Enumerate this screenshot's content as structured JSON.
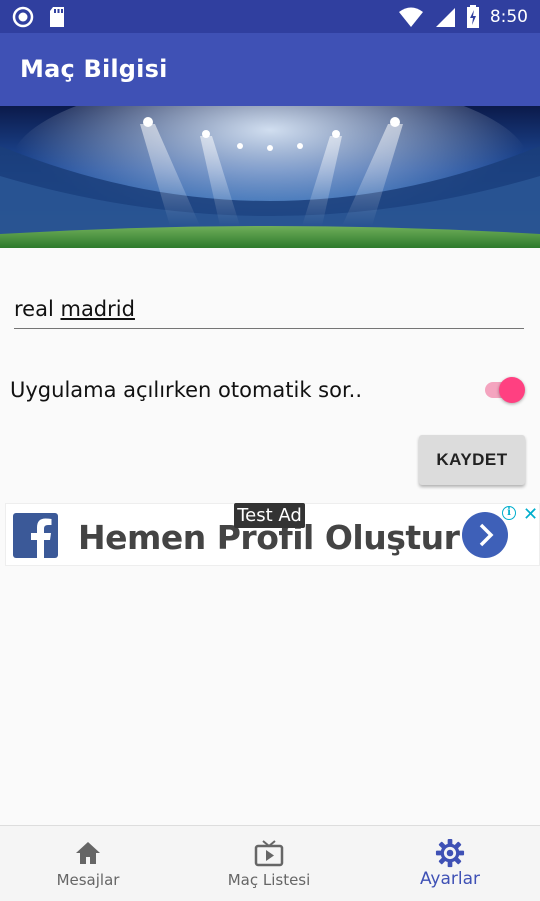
{
  "status_bar": {
    "time": "8:50",
    "battery_level": 0.4
  },
  "app_bar": {
    "title": "Maç Bilgisi"
  },
  "form": {
    "team_word1": "real",
    "team_word2": "madrid",
    "auto_query_label": "Uygulama açılırken otomatik sor..",
    "auto_query_enabled": true,
    "save_label": "KAYDET"
  },
  "ad": {
    "badge": "Test Ad",
    "text": "Hemen Profil Oluştur",
    "info_glyph": "i",
    "close_glyph": "✕"
  },
  "bottom_nav": {
    "items": [
      {
        "label": "Mesajlar",
        "icon": "home-icon"
      },
      {
        "label": "Maç Listesi",
        "icon": "tv-play-icon"
      },
      {
        "label": "Ayarlar",
        "icon": "gear-icon",
        "active": true
      }
    ]
  },
  "colors": {
    "primary": "#3f51b5",
    "primary_dark": "#303f9f",
    "accent": "#ff4081"
  }
}
